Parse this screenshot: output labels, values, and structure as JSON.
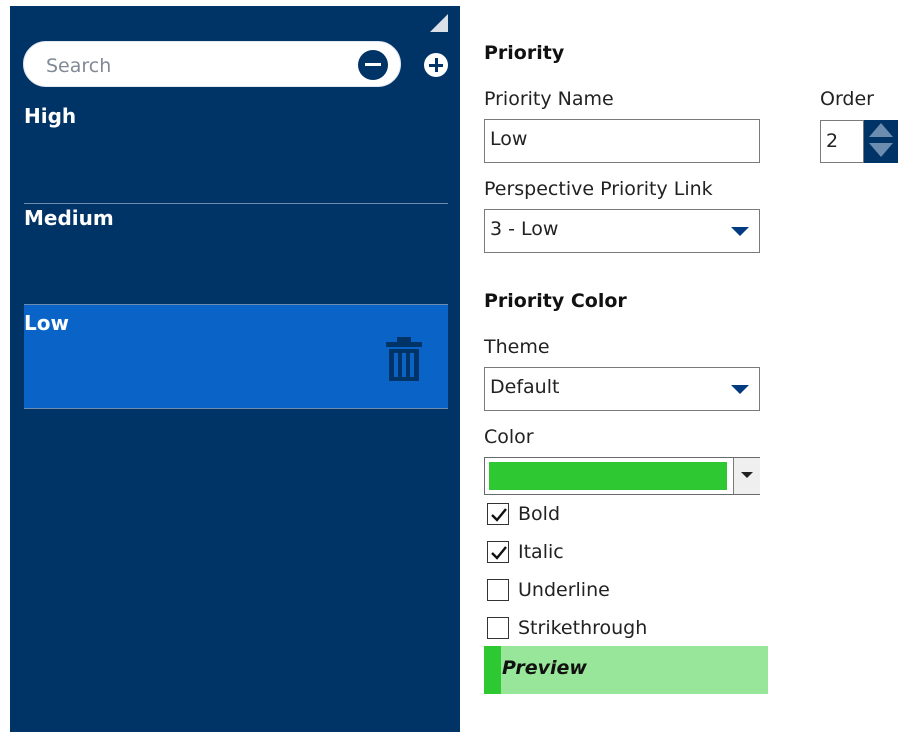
{
  "sidebar": {
    "search": {
      "placeholder": "Search",
      "value": ""
    },
    "items": [
      {
        "label": "High",
        "selected": false
      },
      {
        "label": "Medium",
        "selected": false
      },
      {
        "label": "Low",
        "selected": true
      }
    ],
    "colors": {
      "background": "#003366",
      "selected": "#0a64c8"
    }
  },
  "form": {
    "section_priority": "Priority",
    "priority_name_label": "Priority Name",
    "priority_name_value": "Low",
    "order_label": "Order",
    "order_value": "2",
    "perspective_label": "Perspective Priority Link",
    "perspective_value": "3 - Low",
    "section_color": "Priority Color",
    "theme_label": "Theme",
    "theme_value": "Default",
    "color_label": "Color",
    "color_value": "#2ec832",
    "checkboxes": [
      {
        "label": "Bold",
        "checked": true
      },
      {
        "label": "Italic",
        "checked": true
      },
      {
        "label": "Underline",
        "checked": false
      },
      {
        "label": "Strikethrough",
        "checked": false
      }
    ],
    "preview_label": "Preview",
    "preview_colors": {
      "strip": "#2ec832",
      "background": "#98e69a"
    }
  }
}
